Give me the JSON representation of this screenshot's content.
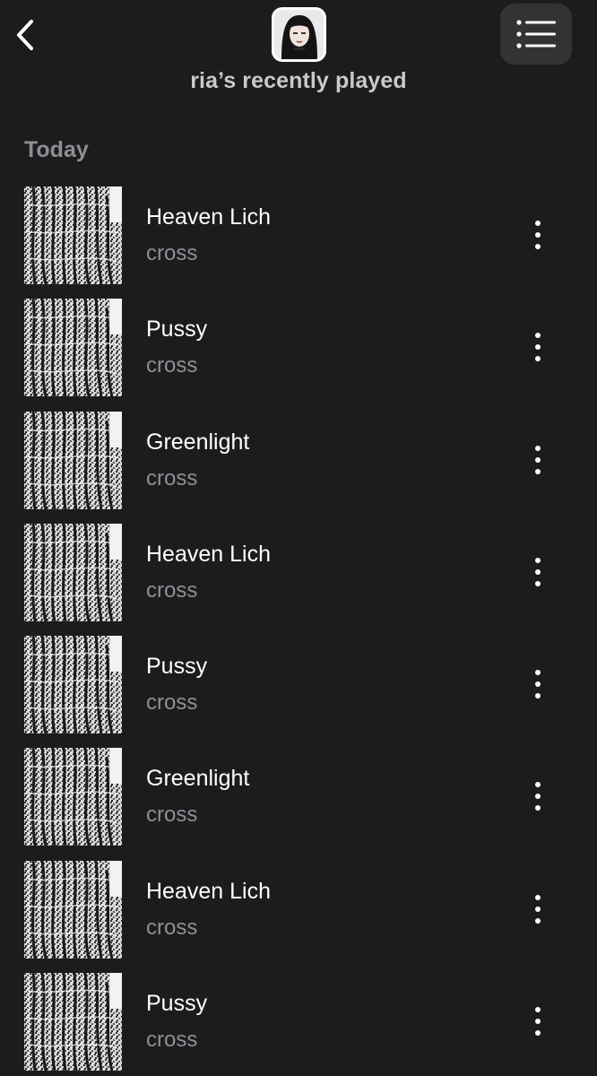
{
  "header": {
    "title": "ria’s recently played",
    "back_icon": "chevron-left-icon",
    "menu_icon": "list-icon",
    "avatar": "profile-avatar"
  },
  "section": {
    "label": "Today"
  },
  "tracks": [
    {
      "title": "Heaven Lich",
      "artist": "cross"
    },
    {
      "title": "Pussy",
      "artist": "cross"
    },
    {
      "title": "Greenlight",
      "artist": "cross"
    },
    {
      "title": "Heaven Lich",
      "artist": "cross"
    },
    {
      "title": "Pussy",
      "artist": "cross"
    },
    {
      "title": "Greenlight",
      "artist": "cross"
    },
    {
      "title": "Heaven Lich",
      "artist": "cross"
    },
    {
      "title": "Pussy",
      "artist": "cross"
    }
  ],
  "colors": {
    "background": "#1c1c1e",
    "primary_text": "#ffffff",
    "secondary_text": "#8e8e93",
    "menu_button_bg": "#333336"
  }
}
